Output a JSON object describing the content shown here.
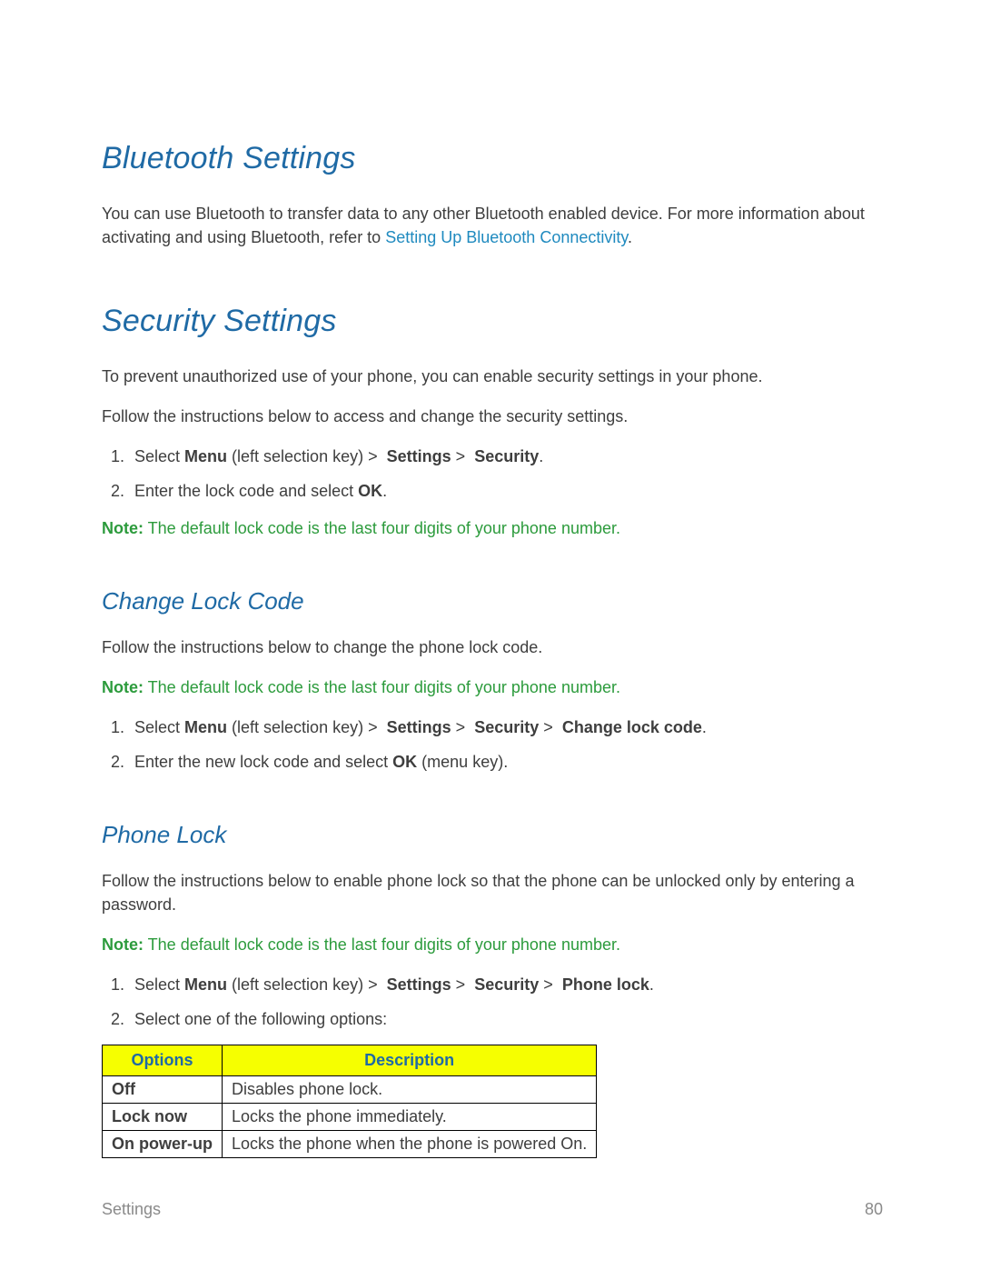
{
  "bluetooth": {
    "heading": "Bluetooth Settings",
    "para_before_link": "You can use Bluetooth to transfer data to any other Bluetooth enabled device. For more information about activating and using Bluetooth, refer to ",
    "link_text": "Setting Up Bluetooth Connectivity",
    "para_after_link": "."
  },
  "security": {
    "heading": "Security Settings",
    "intro1": "To prevent unauthorized use of your phone, you can enable security settings in your phone.",
    "intro2": "Follow the instructions below to access and change the security settings.",
    "step1": {
      "pre": "Select ",
      "menu": "Menu",
      "post_menu": " (left selection key) ",
      "gt": ">",
      "space": " ",
      "settings": "Settings",
      "securityw": "Security",
      "period": "."
    },
    "step2": {
      "pre": "Enter the lock code and select ",
      "ok": "OK",
      "period": "."
    },
    "note_label": "Note:",
    "note_body": " The default lock code is the last four digits of your phone number."
  },
  "change_lock": {
    "heading": "Change Lock Code",
    "intro": "Follow the instructions below to change the phone lock code.",
    "note_label": "Note:",
    "note_body": " The default lock code is the last four digits of your phone number.",
    "step1": {
      "pre": "Select ",
      "menu": "Menu",
      "post_menu": " (left selection key) ",
      "gt": ">",
      "space": " ",
      "settings": "Settings",
      "securityw": "Security",
      "change": "Change lock code",
      "period": "."
    },
    "step2": {
      "pre": "Enter the new lock code and select ",
      "ok": "OK",
      "post": " (menu key)."
    }
  },
  "phone_lock": {
    "heading": "Phone Lock",
    "intro": "Follow the instructions below to enable phone lock so that the phone can be unlocked only by entering a password.",
    "note_label": "Note:",
    "note_body": " The default lock code is the last four digits of your phone number.",
    "step1": {
      "pre": "Select ",
      "menu": "Menu",
      "post_menu": " (left selection key) ",
      "gt": ">",
      "space": " ",
      "settings": "Settings",
      "securityw": "Security",
      "phonelock": "Phone lock",
      "period": "."
    },
    "step2": "Select one of the following options:",
    "table": {
      "headers": {
        "options": "Options",
        "description": "Description"
      },
      "rows": [
        {
          "option": "Off",
          "desc": "Disables phone lock."
        },
        {
          "option": "Lock now",
          "desc": "Locks the phone immediately."
        },
        {
          "option": "On power-up",
          "desc": "Locks the phone when the phone is powered On."
        }
      ]
    }
  },
  "footer": {
    "section": "Settings",
    "page": "80"
  }
}
